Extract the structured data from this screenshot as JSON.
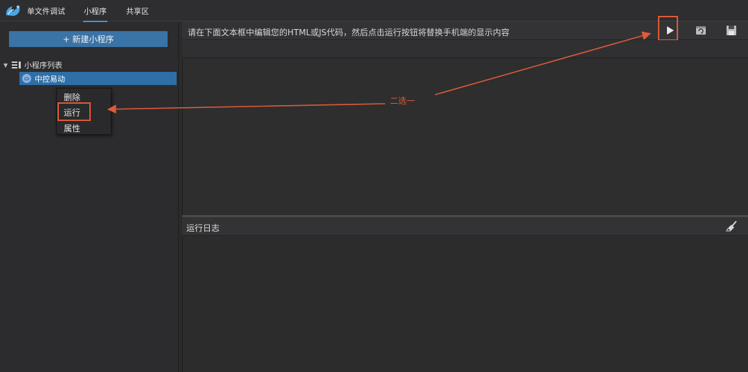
{
  "topnav": {
    "tabs": [
      {
        "label": "单文件调试"
      },
      {
        "label": "小程序"
      },
      {
        "label": "共享区"
      }
    ],
    "active_tab": "小程序"
  },
  "sidebar": {
    "new_button_label": "+ 新建小程序",
    "tree_root_label": "小程序列表",
    "items": [
      {
        "label": "中控易动",
        "selected": true
      }
    ]
  },
  "context_menu": {
    "items": [
      {
        "label": "删除"
      },
      {
        "label": "运行"
      },
      {
        "label": "属性"
      }
    ],
    "highlighted": "运行"
  },
  "editor": {
    "hint": "请在下面文本框中编辑您的HTML或JS代码，然后点击运行按钮将替换手机端的显示内容",
    "toolbar": [
      "play-icon",
      "refresh-icon",
      "save-icon"
    ]
  },
  "log_panel": {
    "title": "运行日志",
    "clear_icon": "broom-icon"
  },
  "annotation": {
    "label": "二选一",
    "color": "#e05a3a"
  },
  "colors": {
    "accent": "#3a73a6",
    "selection": "#2f6fa7",
    "tab_underline": "#4a90d9",
    "background": "#2b2b2b"
  }
}
